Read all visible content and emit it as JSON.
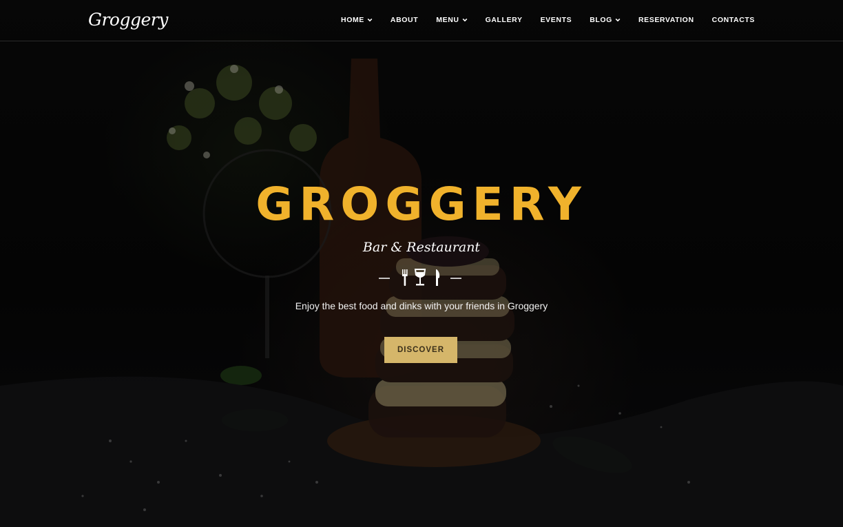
{
  "brand": {
    "logo_text": "Groggery"
  },
  "nav": {
    "items": [
      {
        "label": "HOME",
        "has_dropdown": true
      },
      {
        "label": "ABOUT",
        "has_dropdown": false
      },
      {
        "label": "MENU",
        "has_dropdown": true
      },
      {
        "label": "GALLERY",
        "has_dropdown": false
      },
      {
        "label": "EVENTS",
        "has_dropdown": false
      },
      {
        "label": "BLOG",
        "has_dropdown": true
      },
      {
        "label": "RESERVATION",
        "has_dropdown": false
      },
      {
        "label": "CONTACTS",
        "has_dropdown": false
      }
    ]
  },
  "hero": {
    "title": "GROGGERY",
    "subtitle": "Bar & Restaurant",
    "description": "Enjoy the best food and dinks with your friends in Groggery",
    "cta_label": "DISCOVER",
    "ornament_icons": [
      "fork-icon",
      "wine-glass-icon",
      "knife-icon"
    ]
  },
  "colors": {
    "accent": "#f0b22c",
    "button_bg": "#d5b66a",
    "header_divider": "#2a2a2a"
  }
}
